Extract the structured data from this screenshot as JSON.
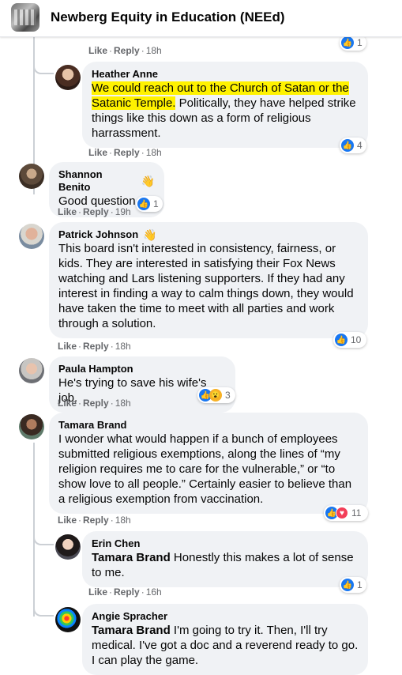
{
  "header": {
    "title": "Newberg Equity in Education (NEEd)"
  },
  "actions": {
    "like": "Like",
    "reply": "Reply",
    "dot": "·"
  },
  "top_actions": {
    "time": "18h",
    "reactions": "1"
  },
  "comments": [
    {
      "author": "Heather Anne",
      "highlighted_text": "We could reach out to the Church of Satan or the",
      "highlighted_text2": "Satanic Temple.",
      "text_rest": " Politically, they have helped strike things like this down as a form of religious harrassment.",
      "time": "18h",
      "reactions": "4"
    },
    {
      "author": "Shannon Benito",
      "text": "Good question.",
      "emoji": "🤔",
      "time": "19h",
      "reactions": "1"
    },
    {
      "author": "Patrick Johnson",
      "text": "This board isn't interested in consistency, fairness, or kids. They are interested in satisfying their Fox News watching and Lars listening supporters. If they had any interest in finding a way to calm things down, they would have taken the time to meet with all parties and work through a solution.",
      "time": "18h",
      "reactions": "10"
    },
    {
      "author": "Paula Hampton",
      "text": "He's trying to save his wife's job.",
      "time": "18h",
      "reactions": "3"
    },
    {
      "author": "Tamara Brand",
      "text": "I wonder what would happen if a bunch of employees submitted religious exemptions, along the lines of “my religion requires me to care for the vulnerable,” or “to show love to all people.” Certainly easier to believe than a religious exemption from vaccination.",
      "time": "18h",
      "reactions": "11"
    },
    {
      "author": "Erin Chen",
      "mention": "Tamara Brand",
      "text": " Honestly this makes a lot of sense to me.",
      "time": "16h",
      "reactions": "1"
    },
    {
      "author": "Angie Spracher",
      "mention": "Tamara Brand",
      "text": " I'm going to try it. Then, I'll try medical. I've got a doc and a reverend ready to go. I can play the game."
    }
  ],
  "colors": {
    "accent": "#1877f2",
    "bubble": "#f0f2f5",
    "highlight": "#fff200",
    "love": "#f33e58"
  },
  "icons": {
    "top_fan": "wave-icon",
    "like": "like-icon",
    "love": "love-icon",
    "wow": "wow-icon"
  }
}
